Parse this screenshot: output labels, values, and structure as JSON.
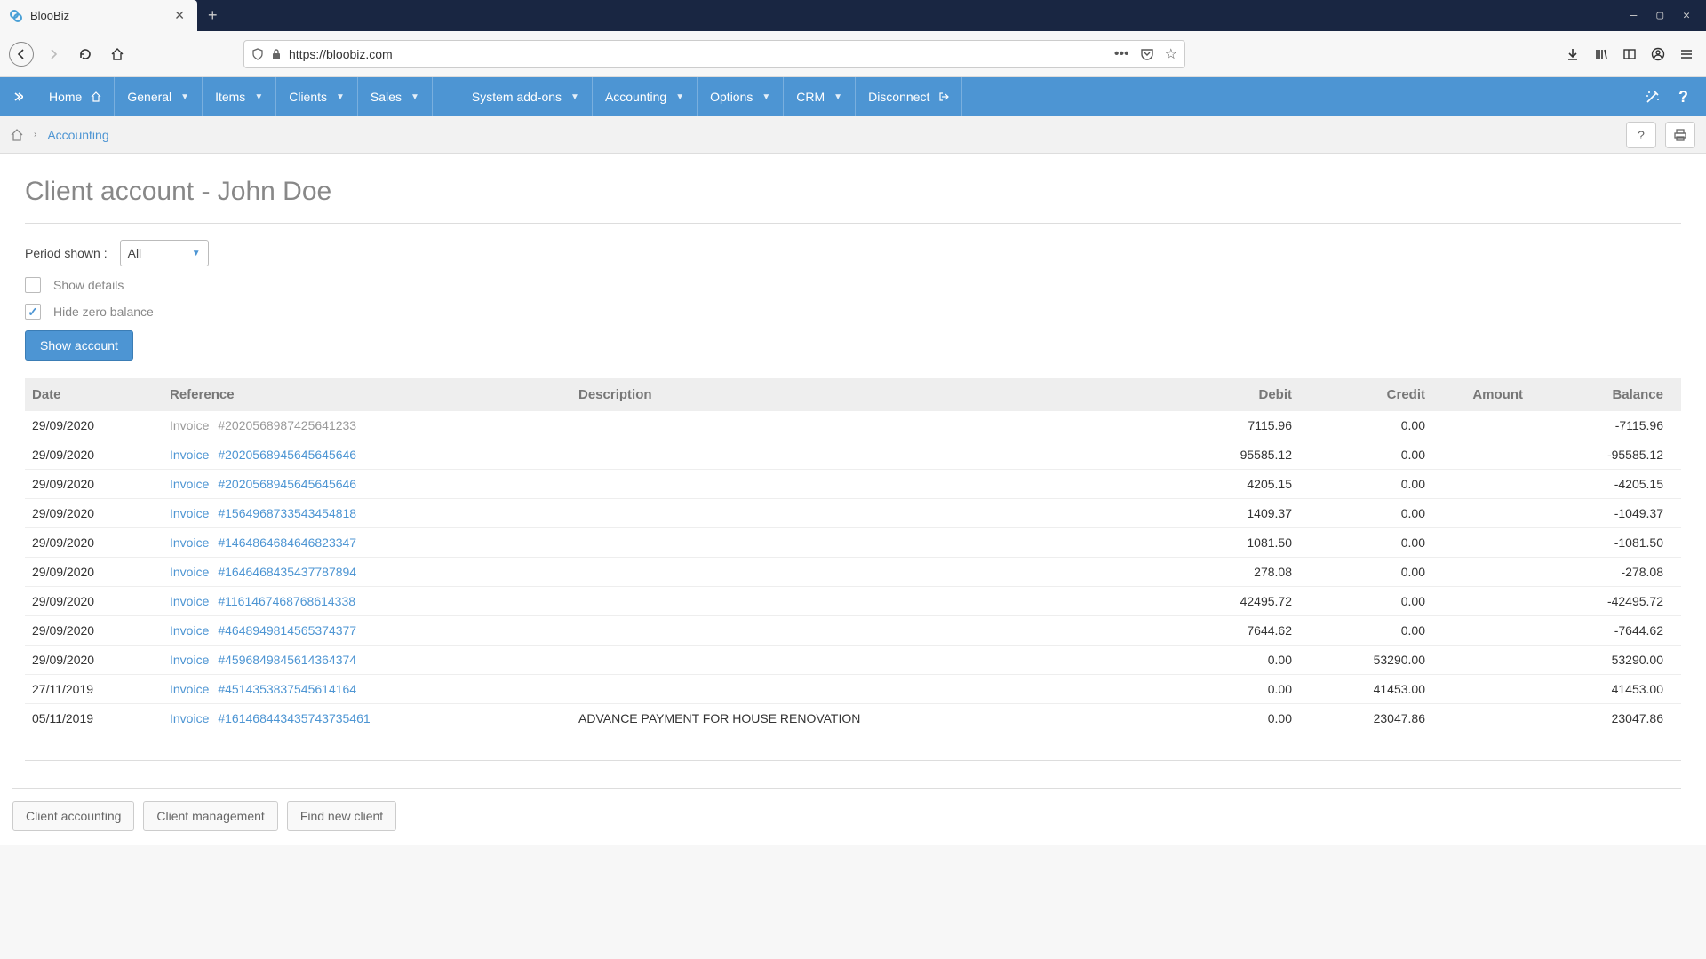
{
  "browser": {
    "tab_title": "BlooBiz",
    "url": "https://bloobiz.com"
  },
  "nav": {
    "items": [
      "Home",
      "General",
      "Items",
      "Clients",
      "Sales",
      "System add-ons",
      "Accounting",
      "Options",
      "CRM",
      "Disconnect"
    ]
  },
  "breadcrumb": {
    "current": "Accounting"
  },
  "page": {
    "title": "Client account - John Doe"
  },
  "controls": {
    "period_label": "Period shown :",
    "period_value": "All",
    "show_details_label": "Show details",
    "hide_zero_label": "Hide zero balance",
    "show_account_btn": "Show account"
  },
  "table": {
    "headers": {
      "date": "Date",
      "reference": "Reference",
      "description": "Description",
      "debit": "Debit",
      "credit": "Credit",
      "amount": "Amount",
      "balance": "Balance"
    },
    "rows": [
      {
        "date": "29/09/2020",
        "ref_prefix": "Invoice",
        "ref_num": "#2020568987425641233",
        "link": false,
        "desc": "",
        "debit": "7115.96",
        "credit": "0.00",
        "amount": "",
        "balance": "-7115.96"
      },
      {
        "date": "29/09/2020",
        "ref_prefix": "Invoice",
        "ref_num": "#2020568945645645646",
        "link": true,
        "desc": "",
        "debit": "95585.12",
        "credit": "0.00",
        "amount": "",
        "balance": "-95585.12"
      },
      {
        "date": "29/09/2020",
        "ref_prefix": "Invoice",
        "ref_num": "#2020568945645645646",
        "link": true,
        "desc": "",
        "debit": "4205.15",
        "credit": "0.00",
        "amount": "",
        "balance": "-4205.15"
      },
      {
        "date": "29/09/2020",
        "ref_prefix": "Invoice",
        "ref_num": "#1564968733543454818",
        "link": true,
        "desc": "",
        "debit": "1409.37",
        "credit": "0.00",
        "amount": "",
        "balance": "-1049.37"
      },
      {
        "date": "29/09/2020",
        "ref_prefix": "Invoice",
        "ref_num": "#1464864684646823347",
        "link": true,
        "desc": "",
        "debit": "1081.50",
        "credit": "0.00",
        "amount": "",
        "balance": "-1081.50"
      },
      {
        "date": "29/09/2020",
        "ref_prefix": "Invoice",
        "ref_num": "#1646468435437787894",
        "link": true,
        "desc": "",
        "debit": "278.08",
        "credit": "0.00",
        "amount": "",
        "balance": "-278.08"
      },
      {
        "date": "29/09/2020",
        "ref_prefix": "Invoice",
        "ref_num": "#1161467468768614338",
        "link": true,
        "desc": "",
        "debit": "42495.72",
        "credit": "0.00",
        "amount": "",
        "balance": "-42495.72"
      },
      {
        "date": "29/09/2020",
        "ref_prefix": "Invoice",
        "ref_num": "#4648949814565374377",
        "link": true,
        "desc": "",
        "debit": "7644.62",
        "credit": "0.00",
        "amount": "",
        "balance": "-7644.62"
      },
      {
        "date": "29/09/2020",
        "ref_prefix": "Invoice",
        "ref_num": "#4596849845614364374",
        "link": true,
        "desc": "",
        "debit": "0.00",
        "credit": "53290.00",
        "amount": "",
        "balance": "53290.00"
      },
      {
        "date": "27/11/2019",
        "ref_prefix": "Invoice",
        "ref_num": "#4514353837545614164",
        "link": true,
        "desc": "",
        "debit": "0.00",
        "credit": "41453.00",
        "amount": "",
        "balance": "41453.00"
      },
      {
        "date": "05/11/2019",
        "ref_prefix": "Invoice",
        "ref_num": "#161468443435743735461",
        "link": true,
        "desc": "ADVANCE PAYMENT FOR HOUSE RENOVATION",
        "debit": "0.00",
        "credit": "23047.86",
        "amount": "",
        "balance": "23047.86"
      }
    ]
  },
  "footer": {
    "client_accounting": "Client accounting",
    "client_management": "Client management",
    "find_new_client": "Find new client"
  }
}
